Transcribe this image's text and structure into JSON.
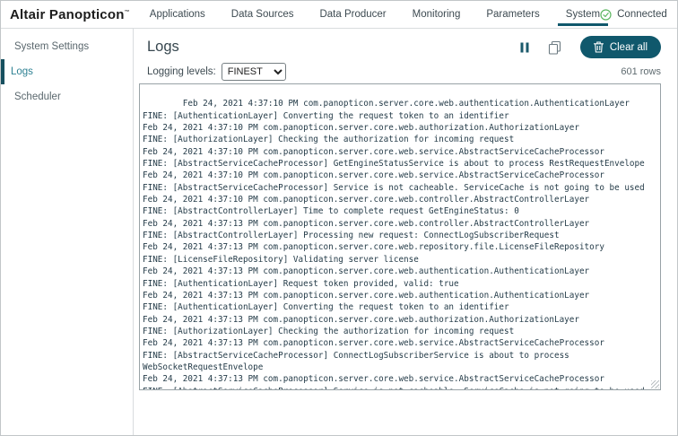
{
  "header": {
    "logo": "Altair Panopticon",
    "trademark": "™",
    "tabs": [
      "Applications",
      "Data Sources",
      "Data Producer",
      "Monitoring",
      "Parameters",
      "System"
    ],
    "active_tab": "System",
    "connection_status": "Connected"
  },
  "sidebar": {
    "items": [
      "System Settings",
      "Logs",
      "Scheduler"
    ],
    "active_item": "Logs"
  },
  "main": {
    "title": "Logs",
    "clear_button_label": "Clear all",
    "logging_levels_label": "Logging levels:",
    "logging_level_selected": "FINEST",
    "row_count": "601 rows"
  },
  "icons": {
    "pause": "pause-icon",
    "copy": "copy-icon",
    "clear": "trash-icon",
    "connected": "check-circle-icon",
    "account": "person-icon",
    "dropdown": "chevron-down-icon"
  },
  "colors": {
    "accent_teal": "#10586c",
    "sidebar_active": "#2e8193",
    "connected_green": "#5cb660",
    "log_text": "#253c49"
  },
  "log": {
    "lines": [
      "Feb 24, 2021 4:37:10 PM com.panopticon.server.core.web.authentication.AuthenticationLayer",
      "FINE: [AuthenticationLayer] Converting the request token to an identifier",
      "Feb 24, 2021 4:37:10 PM com.panopticon.server.core.web.authorization.AuthorizationLayer",
      "FINE: [AuthorizationLayer] Checking the authorization for incoming request",
      "Feb 24, 2021 4:37:10 PM com.panopticon.server.core.web.service.AbstractServiceCacheProcessor",
      "FINE: [AbstractServiceCacheProcessor] GetEngineStatusService is about to process RestRequestEnvelope",
      "Feb 24, 2021 4:37:10 PM com.panopticon.server.core.web.service.AbstractServiceCacheProcessor",
      "FINE: [AbstractServiceCacheProcessor] Service is not cacheable. ServiceCache is not going to be used",
      "Feb 24, 2021 4:37:10 PM com.panopticon.server.core.web.controller.AbstractControllerLayer",
      "FINE: [AbstractControllerLayer] Time to complete request GetEngineStatus: 0",
      "Feb 24, 2021 4:37:13 PM com.panopticon.server.core.web.controller.AbstractControllerLayer",
      "FINE: [AbstractControllerLayer] Processing new request: ConnectLogSubscriberRequest",
      "Feb 24, 2021 4:37:13 PM com.panopticon.server.core.web.repository.file.LicenseFileRepository",
      "FINE: [LicenseFileRepository] Validating server license",
      "Feb 24, 2021 4:37:13 PM com.panopticon.server.core.web.authentication.AuthenticationLayer",
      "FINE: [AuthenticationLayer] Request token provided, valid: true",
      "Feb 24, 2021 4:37:13 PM com.panopticon.server.core.web.authentication.AuthenticationLayer",
      "FINE: [AuthenticationLayer] Converting the request token to an identifier",
      "Feb 24, 2021 4:37:13 PM com.panopticon.server.core.web.authorization.AuthorizationLayer",
      "FINE: [AuthorizationLayer] Checking the authorization for incoming request",
      "Feb 24, 2021 4:37:13 PM com.panopticon.server.core.web.service.AbstractServiceCacheProcessor",
      "FINE: [AbstractServiceCacheProcessor] ConnectLogSubscriberService is about to process",
      "WebSocketRequestEnvelope",
      "Feb 24, 2021 4:37:13 PM com.panopticon.server.core.web.service.AbstractServiceCacheProcessor",
      "FINE: [AbstractServiceCacheProcessor] Service is not cacheable. ServiceCache is not going to be used"
    ]
  }
}
